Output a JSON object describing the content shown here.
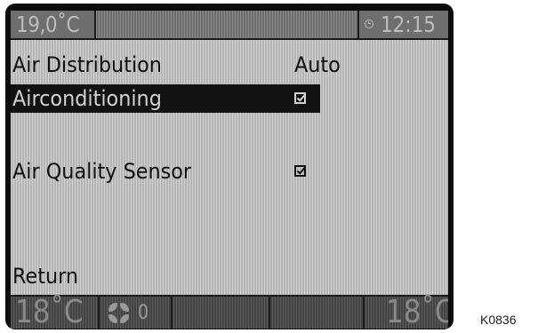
{
  "status_bar": {
    "temperature": "19,0˚C",
    "time": "12:15",
    "clock_icon": "clock-icon"
  },
  "menu": {
    "items": [
      {
        "label": "Air  Distribution",
        "value": "Auto"
      },
      {
        "label": "Airconditioning",
        "checked": true,
        "selected": true
      },
      {
        "label": "Air  Quality  Sensor",
        "checked": true
      }
    ],
    "return_label": "Return"
  },
  "climate_bar": {
    "left_temp": "18˚C",
    "right_temp": "18˚C",
    "fan_icon": "fan-icon",
    "fan_level": "0"
  },
  "figure_code": "K0836",
  "colors": {
    "screen_bg": "#c9c9c9",
    "selection_bg": "#121212",
    "bezel": "#0d0d0d"
  }
}
